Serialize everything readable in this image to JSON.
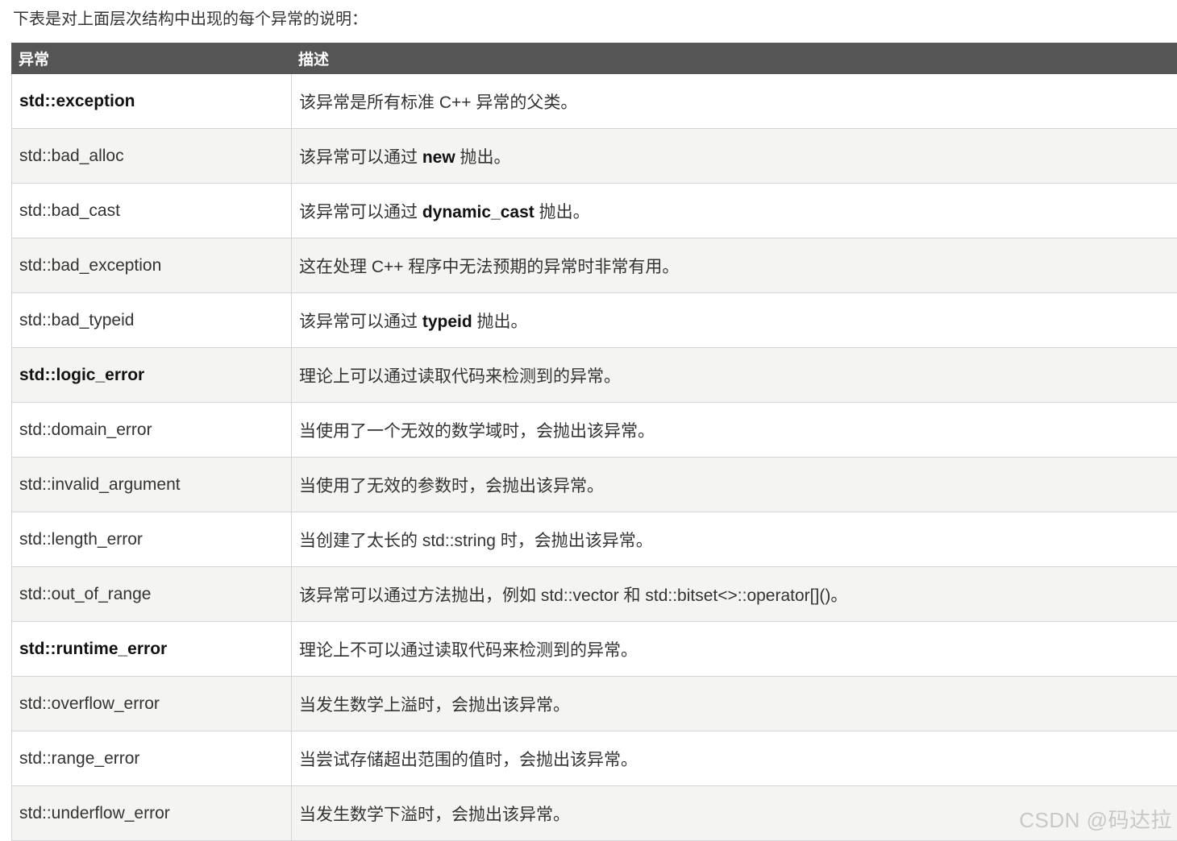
{
  "intro": "下表是对上面层次结构中出现的每个异常的说明：",
  "table": {
    "headers": [
      "异常",
      "描述"
    ],
    "rows": [
      {
        "name": "std::exception",
        "bold": true,
        "desc_pre": "该异常是所有标准 C++ 异常的父类。",
        "desc_bold": "",
        "desc_post": ""
      },
      {
        "name": "std::bad_alloc",
        "bold": false,
        "desc_pre": "该异常可以通过 ",
        "desc_bold": "new",
        "desc_post": " 抛出。"
      },
      {
        "name": "std::bad_cast",
        "bold": false,
        "desc_pre": "该异常可以通过 ",
        "desc_bold": "dynamic_cast",
        "desc_post": " 抛出。"
      },
      {
        "name": "std::bad_exception",
        "bold": false,
        "desc_pre": "这在处理 C++ 程序中无法预期的异常时非常有用。",
        "desc_bold": "",
        "desc_post": ""
      },
      {
        "name": "std::bad_typeid",
        "bold": false,
        "desc_pre": "该异常可以通过 ",
        "desc_bold": "typeid",
        "desc_post": " 抛出。"
      },
      {
        "name": "std::logic_error",
        "bold": true,
        "desc_pre": "理论上可以通过读取代码来检测到的异常。",
        "desc_bold": "",
        "desc_post": ""
      },
      {
        "name": "std::domain_error",
        "bold": false,
        "desc_pre": "当使用了一个无效的数学域时，会抛出该异常。",
        "desc_bold": "",
        "desc_post": ""
      },
      {
        "name": "std::invalid_argument",
        "bold": false,
        "desc_pre": "当使用了无效的参数时，会抛出该异常。",
        "desc_bold": "",
        "desc_post": ""
      },
      {
        "name": "std::length_error",
        "bold": false,
        "desc_pre": "当创建了太长的 std::string 时，会抛出该异常。",
        "desc_bold": "",
        "desc_post": ""
      },
      {
        "name": "std::out_of_range",
        "bold": false,
        "desc_pre": "该异常可以通过方法抛出，例如 std::vector 和 std::bitset<>::operator[]()。",
        "desc_bold": "",
        "desc_post": ""
      },
      {
        "name": "std::runtime_error",
        "bold": true,
        "desc_pre": "理论上不可以通过读取代码来检测到的异常。",
        "desc_bold": "",
        "desc_post": ""
      },
      {
        "name": "std::overflow_error",
        "bold": false,
        "desc_pre": "当发生数学上溢时，会抛出该异常。",
        "desc_bold": "",
        "desc_post": ""
      },
      {
        "name": "std::range_error",
        "bold": false,
        "desc_pre": "当尝试存储超出范围的值时，会抛出该异常。",
        "desc_bold": "",
        "desc_post": ""
      },
      {
        "name": "std::underflow_error",
        "bold": false,
        "desc_pre": "当发生数学下溢时，会抛出该异常。",
        "desc_bold": "",
        "desc_post": ""
      }
    ]
  },
  "watermark": "CSDN @码达拉"
}
